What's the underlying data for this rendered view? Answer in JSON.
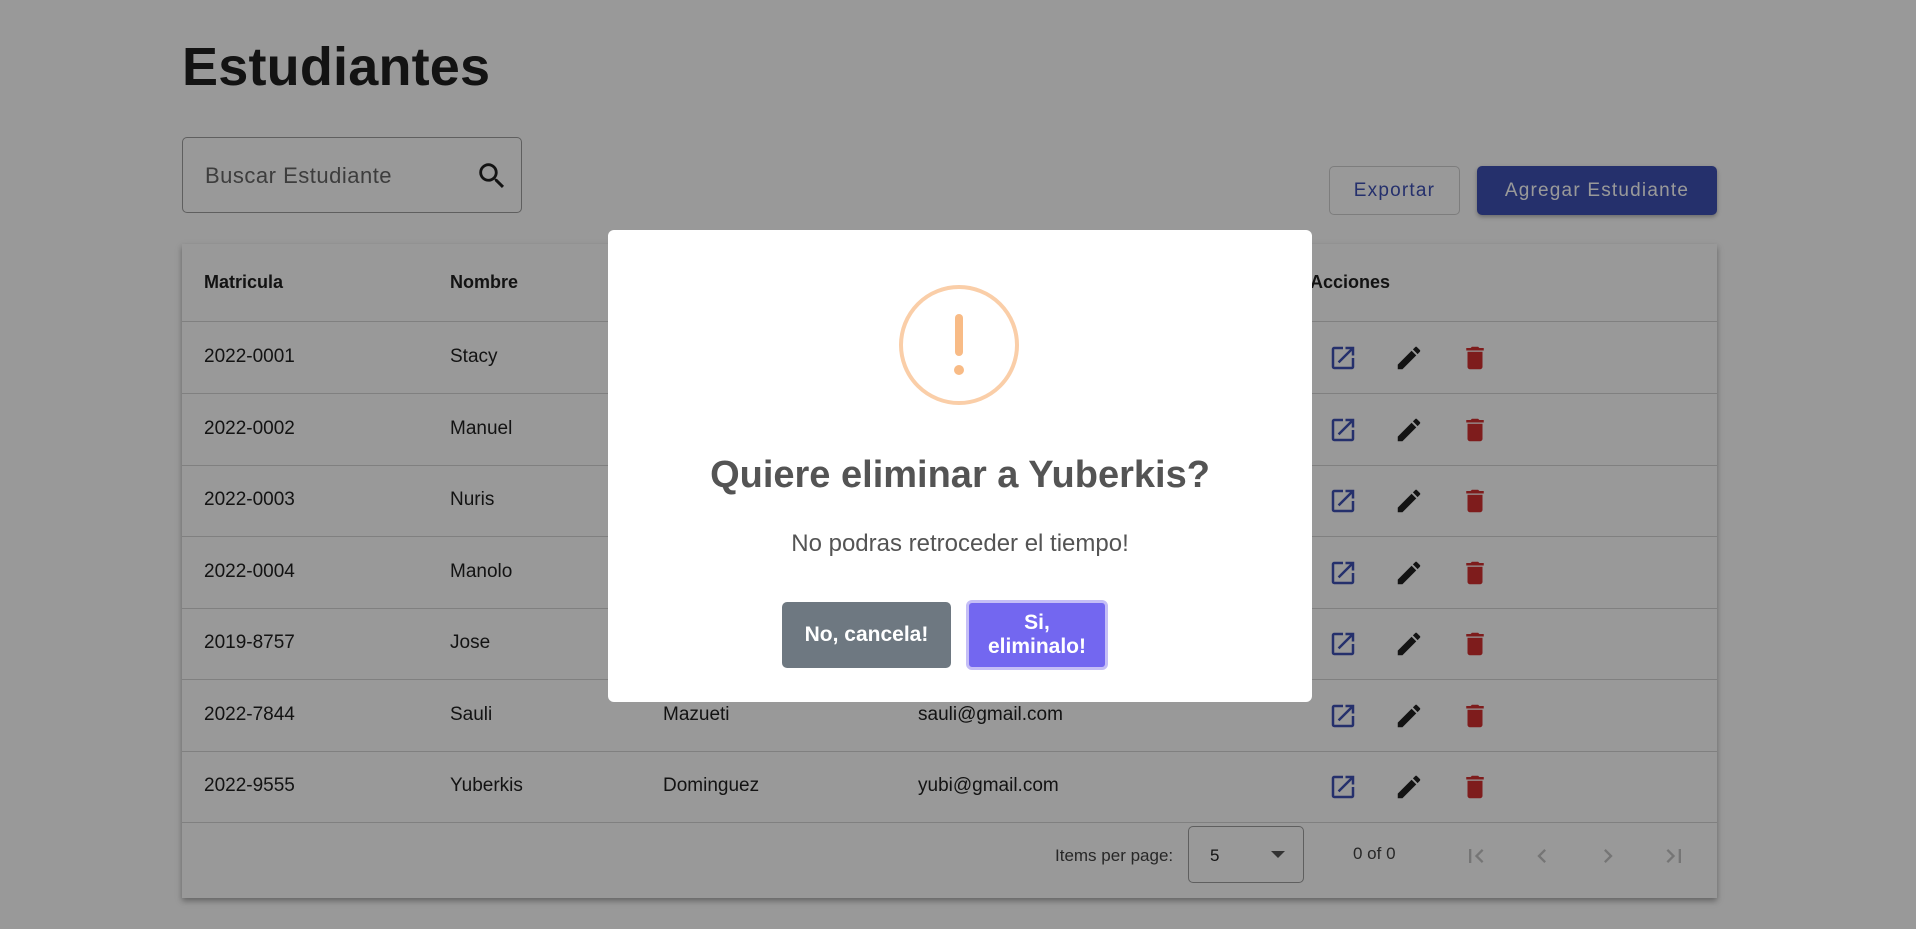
{
  "page": {
    "title": "Estudiantes"
  },
  "search": {
    "placeholder": "Buscar Estudiante",
    "icon": "search-icon"
  },
  "toolbar": {
    "export_label": "Exportar",
    "add_label": "Agregar Estudiante",
    "accent": "#3f51b5"
  },
  "table": {
    "headers": {
      "matricula": "Matricula",
      "nombre": "Nombre",
      "acciones": "Acciones"
    },
    "rows": [
      {
        "matricula": "2022-0001",
        "nombre": "Stacy",
        "apellido": "",
        "correo": ""
      },
      {
        "matricula": "2022-0002",
        "nombre": "Manuel",
        "apellido": "",
        "correo": ""
      },
      {
        "matricula": "2022-0003",
        "nombre": "Nuris",
        "apellido": "",
        "correo": ""
      },
      {
        "matricula": "2022-0004",
        "nombre": "Manolo",
        "apellido": "",
        "correo": ""
      },
      {
        "matricula": "2019-8757",
        "nombre": "Jose",
        "apellido": "",
        "correo": ""
      },
      {
        "matricula": "2022-7844",
        "nombre": "Sauli",
        "apellido": "Mazueti",
        "correo": "sauli@gmail.com"
      },
      {
        "matricula": "2022-9555",
        "nombre": "Yuberkis",
        "apellido": "Dominguez",
        "correo": "yubi@gmail.com"
      }
    ],
    "action_icons": [
      "open-in-new-icon",
      "edit-pencil-icon",
      "delete-trash-icon"
    ],
    "delete_color": "#d32f2f"
  },
  "paginator": {
    "items_per_page_label": "Items per page:",
    "page_size": "5",
    "range_label": "0 of 0"
  },
  "dialog": {
    "icon": "warning-exclamation-icon",
    "icon_color": "#f8bb86",
    "title": "Quiere eliminar a Yuberkis?",
    "text": "No podras retroceder el tiempo!",
    "cancel_label": "No, cancela!",
    "confirm_label": "Si, eliminalo!",
    "confirm_color": "#7367f0",
    "cancel_color": "#6e7881"
  }
}
